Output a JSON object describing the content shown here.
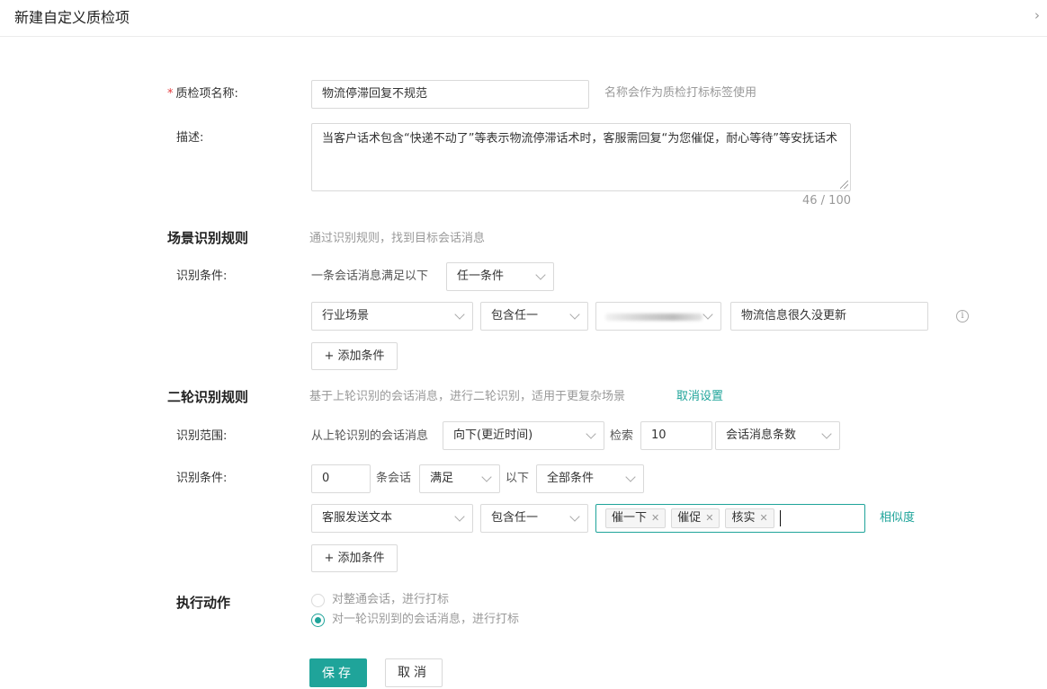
{
  "header": {
    "title": "新建自定义质检项",
    "close_icon": "chevron-right-icon"
  },
  "form": {
    "name": {
      "required_mark": "*",
      "label": "质检项名称:",
      "value": "物流停滞回复不规范",
      "hint": "名称会作为质检打标标签使用"
    },
    "description": {
      "label": "描述:",
      "value": "当客户话术包含“快递不动了”等表示物流停滞话术时，客服需回复“为您催促，耐心等待”等安抚话术",
      "counter": "46 / 100"
    }
  },
  "scene": {
    "title": "场景识别规则",
    "hint": "通过识别规则，找到目标会话消息",
    "condition_label": "识别条件:",
    "condition_prefix": "一条会话消息满足以下",
    "condition_mode": "任一条件",
    "rule": {
      "field": "行业场景",
      "operator": "包含任一",
      "value": "物流信息很久没更新",
      "info_icon": "info-circle-icon"
    },
    "add_button": "+ 添加条件"
  },
  "second": {
    "title": "二轮识别规则",
    "hint": "基于上轮识别的会话消息，进行二轮识别，适用于更复杂场景",
    "cancel_link": "取消设置",
    "range_label": "识别范围:",
    "range_prefix": "从上轮识别的会话消息",
    "direction": "向下(更近时间)",
    "search_label": "检索",
    "search_count": "10",
    "unit": "会话消息条数",
    "condition_label": "识别条件:",
    "offset": "0",
    "offset_suffix": "条会话",
    "satisfy": "满足",
    "below": "以下",
    "scope": "全部条件",
    "rule": {
      "field": "客服发送文本",
      "operator": "包含任一",
      "tags": [
        "催一下",
        "催促",
        "核实"
      ],
      "similarity_link": "相似度"
    },
    "add_button": "+ 添加条件"
  },
  "action": {
    "title": "执行动作",
    "options": [
      "对整通会话，进行打标",
      "对一轮识别到的会话消息，进行打标"
    ],
    "selected_index": 1
  },
  "footer": {
    "save": "保存",
    "cancel": "取消"
  },
  "colors": {
    "accent": "#1fa49a",
    "required": "#e4393c"
  }
}
